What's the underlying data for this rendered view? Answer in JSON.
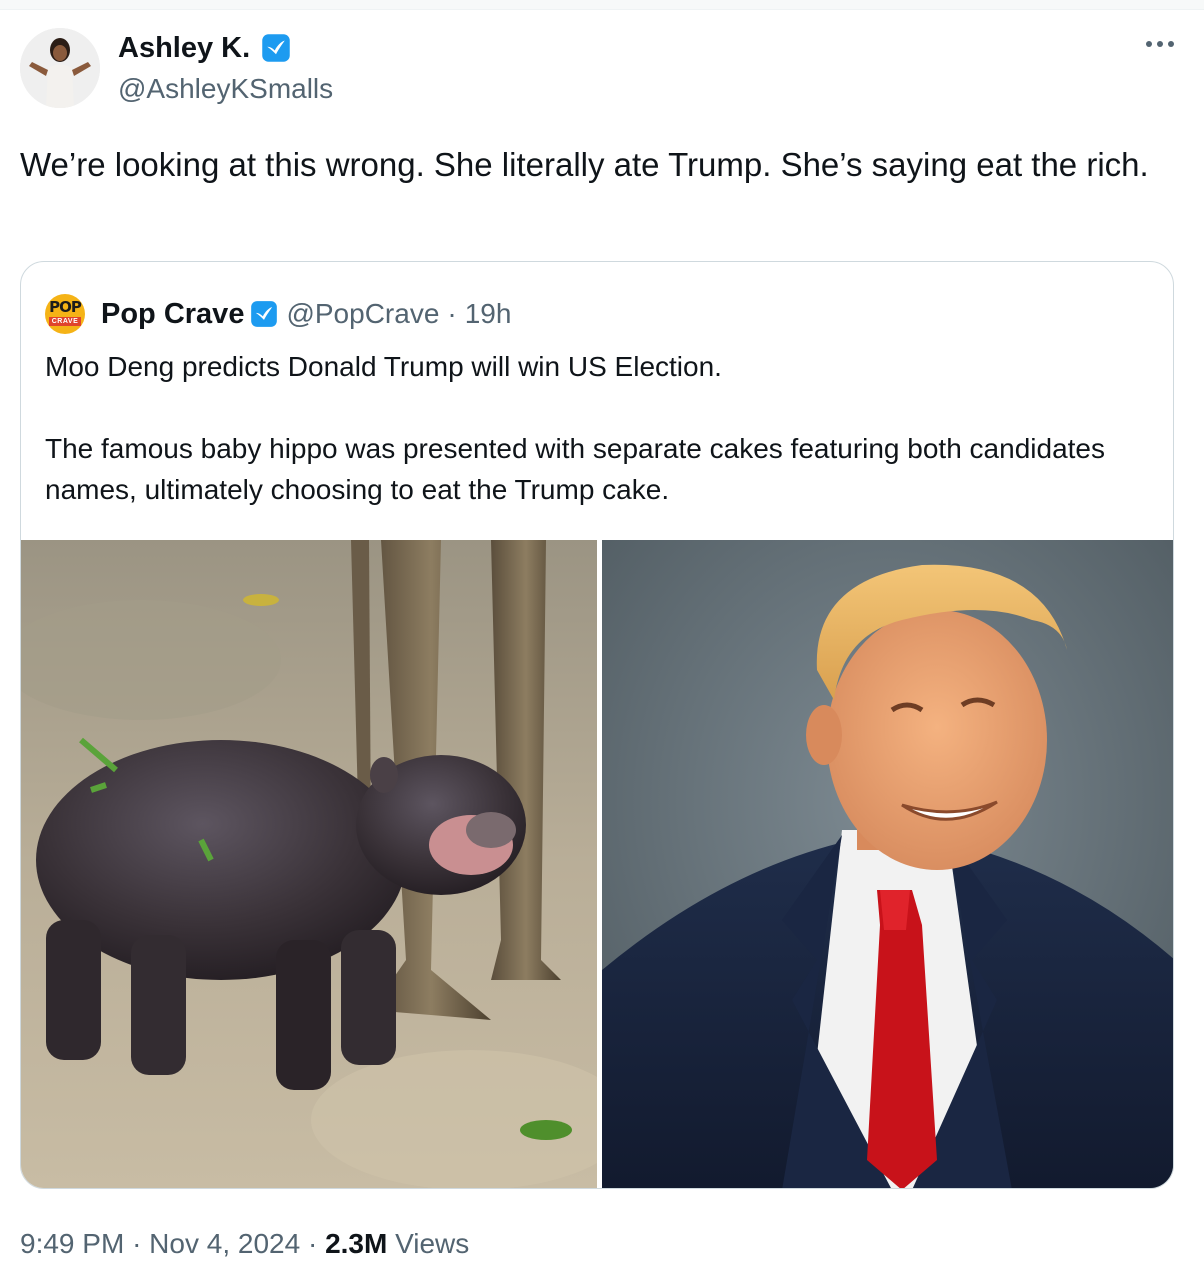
{
  "colors": {
    "verified_badge": "#1d9bf0",
    "secondary_text": "#536471",
    "primary_text": "#0f1419",
    "border": "#cfd9de"
  },
  "author": {
    "name": "Ashley K.",
    "handle": "@AshleyKSmalls",
    "avatar_icon": "person-shrug-avatar",
    "verified": true
  },
  "more_menu_icon": "more-horizontal-icon",
  "tweet": {
    "text": "We’re looking at this wrong. She literally ate Trump. She’s saying eat the rich."
  },
  "quoted_tweet": {
    "logo_text_top": "POP",
    "logo_text_bottom": "CRAVE",
    "name": "Pop Crave",
    "handle": "@PopCrave",
    "separator": "·",
    "time": "19h",
    "text": "Moo Deng predicts Donald Trump will win US Election.\n\nThe famous baby hippo was presented with separate cakes featuring both candidates names, ultimately choosing to eat the Trump cake.",
    "media": [
      {
        "subject": "baby-pygmy-hippo-photo"
      },
      {
        "subject": "portrait-man-suit-red-tie-photo"
      }
    ]
  },
  "meta": {
    "time": "9:49 PM",
    "separator": "·",
    "date": "Nov 4, 2024",
    "views_count": "2.3M",
    "views_label": "Views"
  }
}
